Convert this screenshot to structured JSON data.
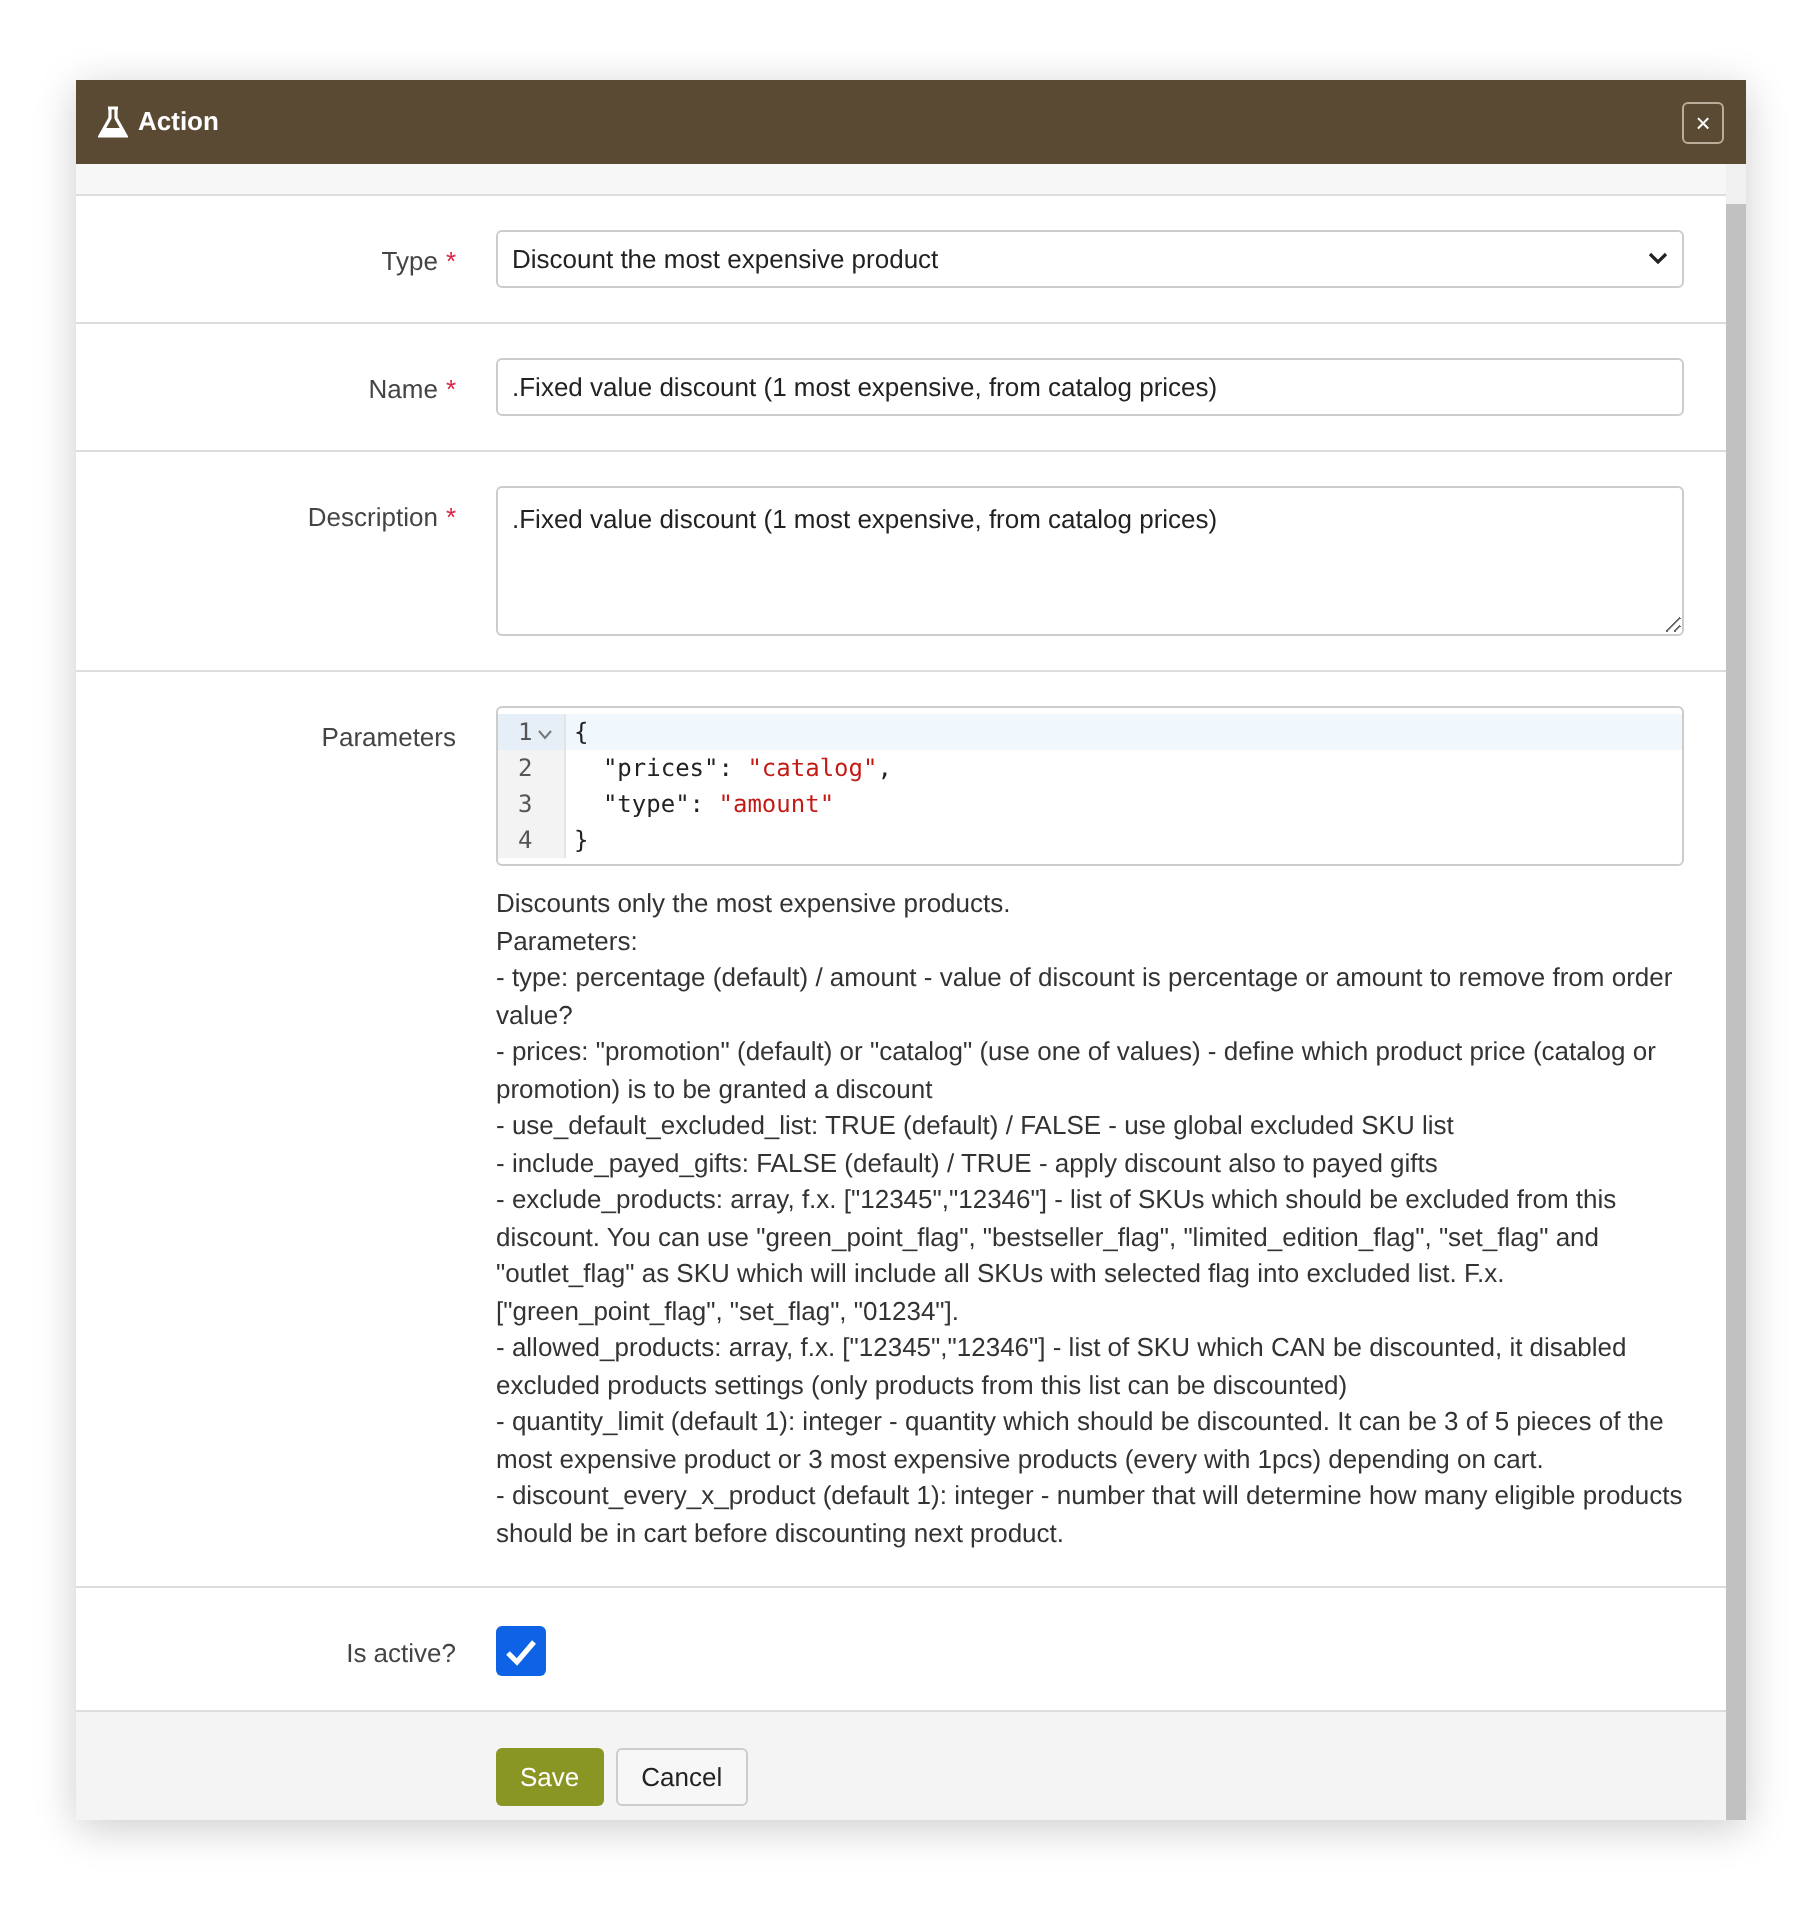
{
  "window": {
    "title": "Action",
    "close_label": "×"
  },
  "fields": [
    {
      "kind": "select",
      "label": "Type",
      "required_mark": "*",
      "value": "Discount the most expensive product"
    },
    {
      "kind": "text",
      "label": "Name",
      "required_mark": "*",
      "value": ".Fixed value discount (1 most expensive, from catalog prices)"
    },
    {
      "kind": "textarea",
      "label": "Description",
      "required_mark": "*",
      "value": ".Fixed value discount (1 most expensive, from catalog prices)"
    },
    {
      "kind": "code",
      "label": "Parameters",
      "code_lines": [
        {
          "number": "1",
          "active": true,
          "foldable": true,
          "tokens": [
            {
              "kind": "punct",
              "text": "{"
            }
          ]
        },
        {
          "number": "2",
          "active": false,
          "foldable": false,
          "tokens": [
            {
              "kind": "key",
              "text": "  \"prices\": "
            },
            {
              "kind": "string",
              "text": "\"catalog\""
            },
            {
              "kind": "punct",
              "text": ","
            }
          ]
        },
        {
          "number": "3",
          "active": false,
          "foldable": false,
          "tokens": [
            {
              "kind": "key",
              "text": "  \"type\": "
            },
            {
              "kind": "string",
              "text": "\"amount\""
            }
          ]
        },
        {
          "number": "4",
          "active": false,
          "foldable": false,
          "tokens": [
            {
              "kind": "punct",
              "text": "}"
            }
          ]
        }
      ],
      "help": [
        "Discounts only the most expensive products.",
        "Parameters:",
        "- type: percentage (default) / amount - value of discount is percentage or amount to remove from order value?",
        "- prices: \"promotion\" (default) or \"catalog\" (use one of values) - define which product price (catalog or promotion) is to be granted a discount",
        "- use_default_excluded_list: TRUE (default) / FALSE - use global excluded SKU list",
        "- include_payed_gifts: FALSE (default) / TRUE - apply discount also to payed gifts",
        "- exclude_products: array, f.x. [\"12345\",\"12346\"] - list of SKUs which should be excluded from this discount. You can use \"green_point_flag\", \"bestseller_flag\", \"limited_edition_flag\", \"set_flag\" and \"outlet_flag\" as SKU which will include all SKUs with selected flag into excluded list. F.x. [\"green_point_flag\", \"set_flag\", \"01234\"].",
        "- allowed_products: array, f.x. [\"12345\",\"12346\"] - list of SKU which CAN be discounted, it disabled excluded products settings (only products from this list can be discounted)",
        "- quantity_limit (default 1): integer - quantity which should be discounted. It can be 3 of 5 pieces of the most expensive product or 3 most expensive products (every with 1pcs) depending on cart.",
        "- discount_every_x_product (default 1): integer - number that will determine how many eligible products should be in cart before discounting next product."
      ]
    },
    {
      "kind": "checkbox",
      "label": "Is active?",
      "checked": true
    }
  ],
  "buttons": [
    {
      "label": "Save",
      "kind": "primary"
    },
    {
      "label": "Cancel",
      "kind": "secondary"
    }
  ]
}
